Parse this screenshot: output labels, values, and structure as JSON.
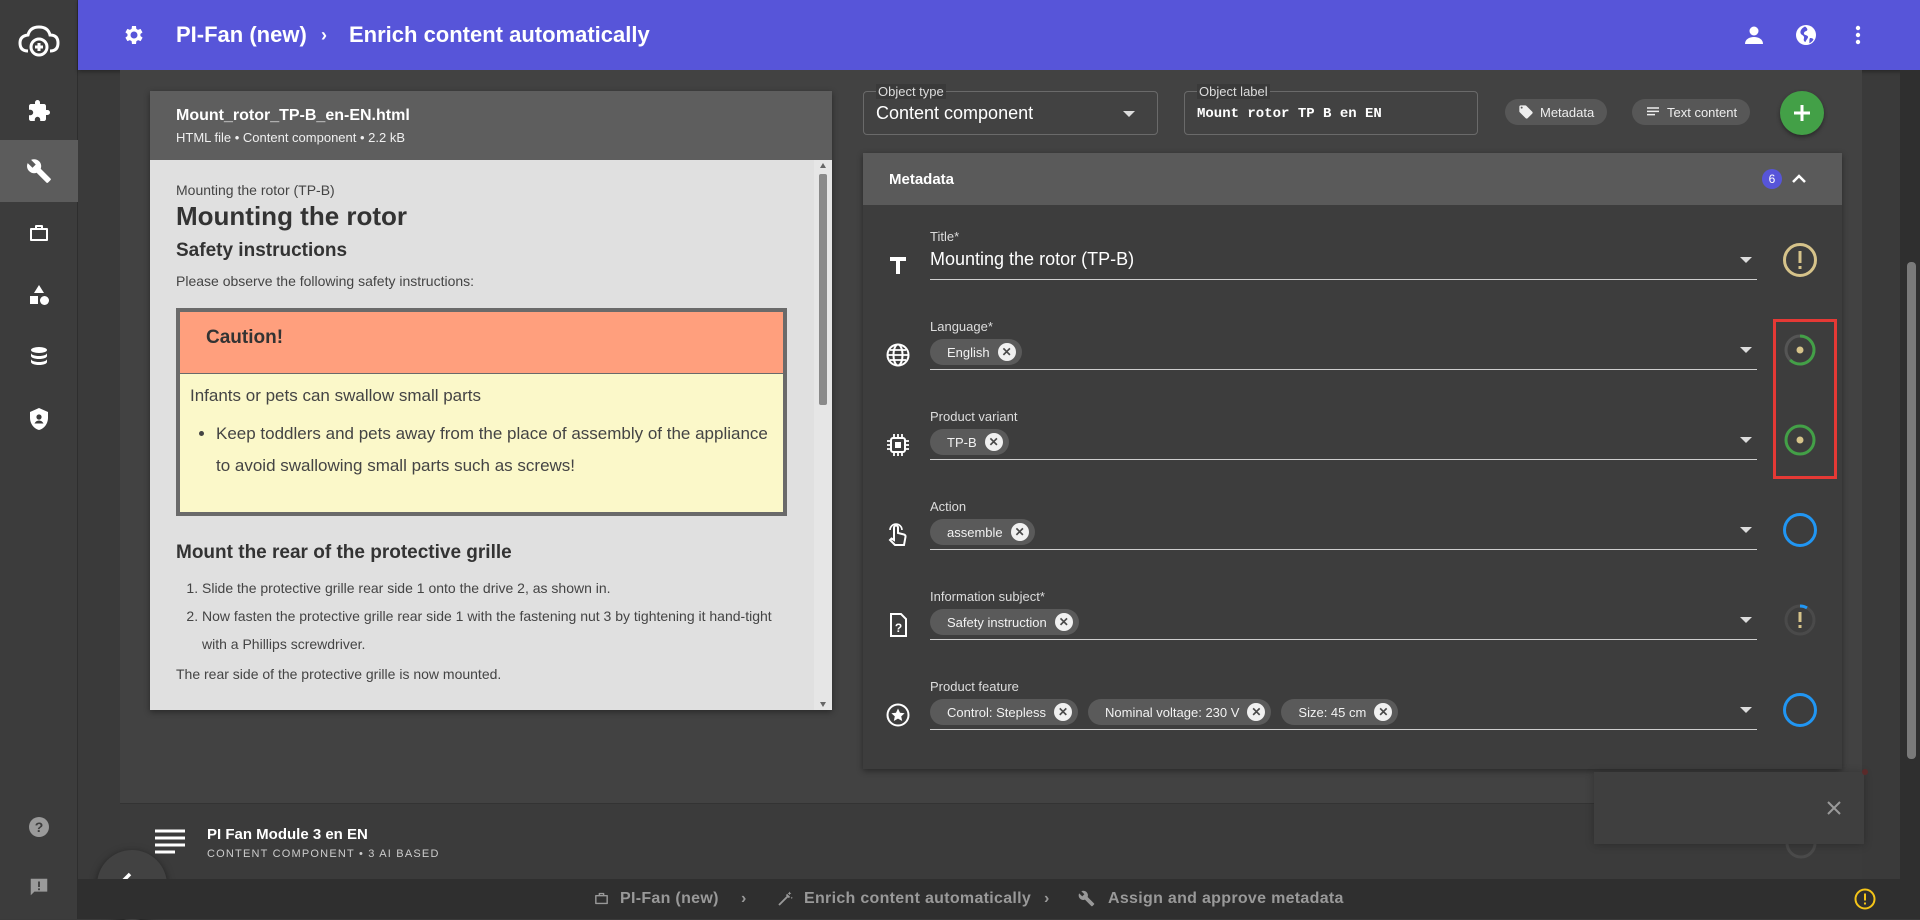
{
  "app": {
    "title": "PI-Fan (new)",
    "page": "Enrich content automatically"
  },
  "preview": {
    "file_name": "Mount_rotor_TP-B_en-EN.html",
    "file_info": "HTML file • Content component • 2.2 kB",
    "doc": {
      "pre_title": "Mounting the rotor (TP-B)",
      "title": "Mounting the rotor",
      "h_safety": "Safety instructions",
      "safety_intro": "Please observe the following safety instructions:",
      "caution": "Caution!",
      "caution_text": "Infants or pets can swallow small parts",
      "caution_bullet": "Keep toddlers and pets away from the place of assembly of the appliance to avoid swallowing small parts such as screws!",
      "h_grille": "Mount the rear of the protective grille",
      "steps": [
        "Slide the protective grille rear side 1 onto the drive 2, as shown in.",
        "Now fasten the protective grille rear side 1 with the fastening nut 3 by tightening it hand-tight with a Phillips screwdriver."
      ],
      "result": "The rear side of the protective grille is now mounted."
    }
  },
  "form": {
    "object_type_label": "Object type",
    "object_type_value": "Content component",
    "object_label_label": "Object label",
    "object_label_value": "Mount rotor TP B en EN",
    "metadata_btn": "Metadata",
    "text_content_btn": "Text content"
  },
  "metadata": {
    "title": "Metadata",
    "count": "6",
    "rows": [
      {
        "label": "Title*",
        "value": "Mounting the rotor (TP-B)",
        "chips": [],
        "status": "warning"
      },
      {
        "label": "Language*",
        "chips": [
          "English"
        ],
        "status": "loading-high"
      },
      {
        "label": "Product variant",
        "chips": [
          "TP-B"
        ],
        "status": "approved"
      },
      {
        "label": "Action",
        "chips": [
          "assemble"
        ],
        "status": "empty"
      },
      {
        "label": "Information subject*",
        "chips": [
          "Safety instruction"
        ],
        "status": "loading-low"
      },
      {
        "label": "Product feature",
        "chips": [
          "Control: Stepless",
          "Nominal voltage: 230 V",
          "Size: 45 cm"
        ],
        "status": "empty"
      }
    ]
  },
  "bottom_card": {
    "title": "PI Fan Module 3 en EN",
    "subtitle": "CONTENT COMPONENT • 3 AI BASED"
  },
  "bottom_breadcrumb": [
    "PI-Fan (new)",
    "Enrich content automatically",
    "Assign and approve metadata"
  ],
  "colors": {
    "accent": "#5755d9",
    "add_button": "#43a047",
    "warning": "#d6c38a",
    "ok_ring": "#43a047",
    "empty_ring": "#2196f3",
    "highlight": "#e53935"
  }
}
